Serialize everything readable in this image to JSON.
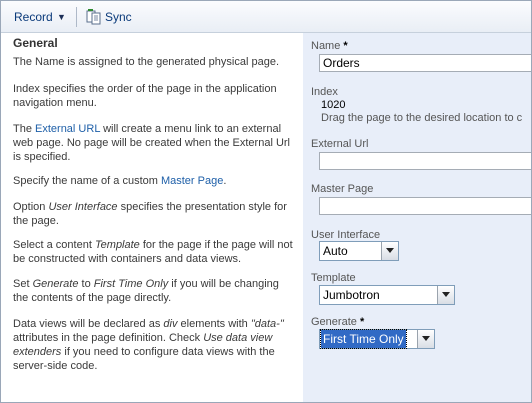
{
  "toolbar": {
    "record_label": "Record",
    "sync_label": "Sync"
  },
  "left": {
    "heading": "General",
    "p1": "The Name is assigned to the generated physical page.",
    "p2": "Index specifies the order of the page in the application navigation menu.",
    "p3_pre": "The ",
    "p3_link": "External URL",
    "p3_post": " will create a menu link to an external web page. No page will be created when the External Url is specified.",
    "p4_pre": "Specify the name of a custom ",
    "p4_link": "Master Page",
    "p4_post": ".",
    "p5_pre": "Option ",
    "p5_em": "User Interface",
    "p5_post": " specifies the presentation style for the page.",
    "p6_pre": "Select a content ",
    "p6_em": "Template",
    "p6_post": " for the page if the page will not be constructed with containers and data views.",
    "p7_a": "Set ",
    "p7_em1": "Generate",
    "p7_b": " to ",
    "p7_em2": "First Time Only",
    "p7_c": " if you will be changing the contents of the page directly.",
    "p8_a": "Data views will be declared as ",
    "p8_em1": "div",
    "p8_b": " elements with ",
    "p8_em2": "\"data-\"",
    "p8_c": " attributes in the page definition. Check ",
    "p8_em3": "Use data view extenders",
    "p8_d": " if you need to configure data views with the server-side code."
  },
  "form": {
    "name_label": "Name",
    "name_required": "*",
    "name_value": "Orders",
    "index_label": "Index",
    "index_value": "1020",
    "index_hint": "Drag the page to the desired location to c",
    "external_url_label": "External Url",
    "external_url_value": "",
    "master_page_label": "Master Page",
    "master_page_value": "",
    "ui_label": "User Interface",
    "ui_value": "Auto",
    "template_label": "Template",
    "template_value": "Jumbotron",
    "generate_label": "Generate",
    "generate_required": "*",
    "generate_value": "First Time Only"
  },
  "colors": {
    "link": "#1e5fa8",
    "panel_bg": "#e8eef9",
    "selection": "#316ac5"
  },
  "icons": {
    "sync": "sync-icon",
    "record_menu": "chevron-down-icon"
  }
}
